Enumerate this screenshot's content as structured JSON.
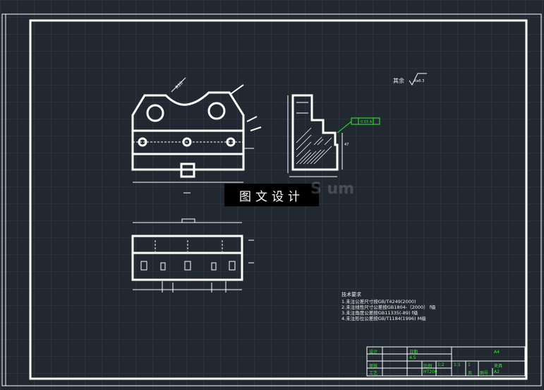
{
  "roughness": {
    "label": "其余",
    "value": "Ra6.3"
  },
  "dimensions": {
    "radius": "R10",
    "tolerance_box": "0.03 A",
    "height": "47"
  },
  "watermark": {
    "label": "图文设计",
    "faint": "S um"
  },
  "tech_requirements": {
    "title": "技术要求",
    "lines": [
      "1.未注公差尺寸按GB/T4249(2000)",
      "2.未注线性尺寸公差按GB1804-（2000） f级",
      "3.未注角度公差按GB11335(-89) f级",
      "4.未注形位公差按GB/T1184(1996) M级"
    ]
  },
  "title_block": {
    "designer": "设计",
    "checker": "审核",
    "process": "工艺",
    "date": "日期",
    "scale_val": "1:2",
    "scale": "1:1",
    "material_val": "HT200",
    "ratio": "比例",
    "qty": "1",
    "page_label": "页",
    "sheet": "A4",
    "part_name": "夹具",
    "drawing_no": "图号",
    "drawing_no_val": "A2",
    "extra": "4.5"
  },
  "colors": {
    "background": "#212830",
    "lines": "#ffffff",
    "annotation": "#2cf02c"
  }
}
